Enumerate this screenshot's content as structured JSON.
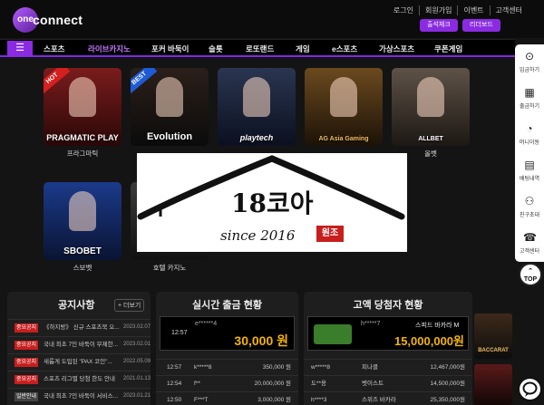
{
  "logo": {
    "mark": "one",
    "word": "connect"
  },
  "toplinks": [
    "로그인",
    "회원가입",
    "이벤트",
    "고객센터"
  ],
  "pills": {
    "attendance": "출석체크",
    "leaderboard": "리더보드"
  },
  "nav": {
    "menu_icon": "☰",
    "items": [
      "스포츠",
      "라이브카지노",
      "포커 바둑이",
      "슬롯",
      "로또랜드",
      "게임",
      "e스포츠",
      "가상스포츠",
      "쿠폰게임"
    ],
    "active_index": 1
  },
  "games": [
    {
      "badge": "HOT",
      "brand": "PRAGMATIC PLAY",
      "label": "프라그마틱"
    },
    {
      "badge": "BEST",
      "brand": "Evolution",
      "label": ""
    },
    {
      "badge": "",
      "brand": "playtech",
      "label": ""
    },
    {
      "badge": "",
      "brand": "AG Asia Gaming",
      "label": ""
    },
    {
      "badge": "",
      "brand": "ALLBET",
      "label": "올벳"
    },
    {
      "badge": "",
      "brand": "SBOBET",
      "label": "스보벳"
    },
    {
      "badge": "",
      "brand": "",
      "label": "호텔 카지노"
    }
  ],
  "overlay": {
    "title": "18코아",
    "since": "since 2016",
    "stamp": "원조"
  },
  "sidebar": [
    {
      "icon": "⊙",
      "label": "입금하기"
    },
    {
      "icon": "▦",
      "label": "출금하기"
    },
    {
      "icon": "◔",
      "label": "머니이동"
    },
    {
      "icon": "▤",
      "label": "배팅내역"
    },
    {
      "icon": "⚇",
      "label": "친구초대"
    },
    {
      "icon": "☎",
      "label": "고객센터"
    }
  ],
  "top_button": {
    "arrow": "⌃",
    "label": "TOP"
  },
  "notice": {
    "title": "공지사항",
    "more": "+ 더보기",
    "rows": [
      {
        "tag": "중요공지",
        "text": "《하지방》 신규 스포츠북 오...",
        "date": "2023.02.07"
      },
      {
        "tag": "중요공지",
        "text": "국내 최초 7인 바둑이 무제한...",
        "date": "2023.02.01"
      },
      {
        "tag": "중요공지",
        "text": "새롭게 도입된 \"PAX 코인\"...",
        "date": "2022.05.09"
      },
      {
        "tag": "중요공지",
        "text": "스포츠 리그별 당첨 한도 안내",
        "date": "2021.01.13"
      },
      {
        "tag": "일반안내",
        "text": "국내 최초 7인 바둑이 서비스...",
        "date": "2023.01.21"
      }
    ]
  },
  "withdraw": {
    "title": "실시간 출금 현황",
    "highlight": {
      "time": "12:57",
      "user": "e******4",
      "amount": "30,000 원"
    },
    "rows": [
      {
        "time": "12:57",
        "user": "k*****8",
        "amount": "350,000 원"
      },
      {
        "time": "12:54",
        "user": "f**",
        "amount": "20,000,000 원"
      },
      {
        "time": "12:50",
        "user": "F***T",
        "amount": "3,000,000 원"
      }
    ]
  },
  "winners": {
    "title": "고액 당첨자 현황",
    "highlight": {
      "user": "h*****7",
      "game": "스피드 바카라 M",
      "amount": "15,000,000원"
    },
    "rows": [
      {
        "user": "w*****8",
        "game": "피나클",
        "amount": "12,467,000원"
      },
      {
        "user": "도**용",
        "game": "벳이스트",
        "amount": "14,500,000원"
      },
      {
        "user": "h****3",
        "game": "스위즈 바카라",
        "amount": "25,350,000원"
      }
    ],
    "side_game": "BACCARAT"
  }
}
